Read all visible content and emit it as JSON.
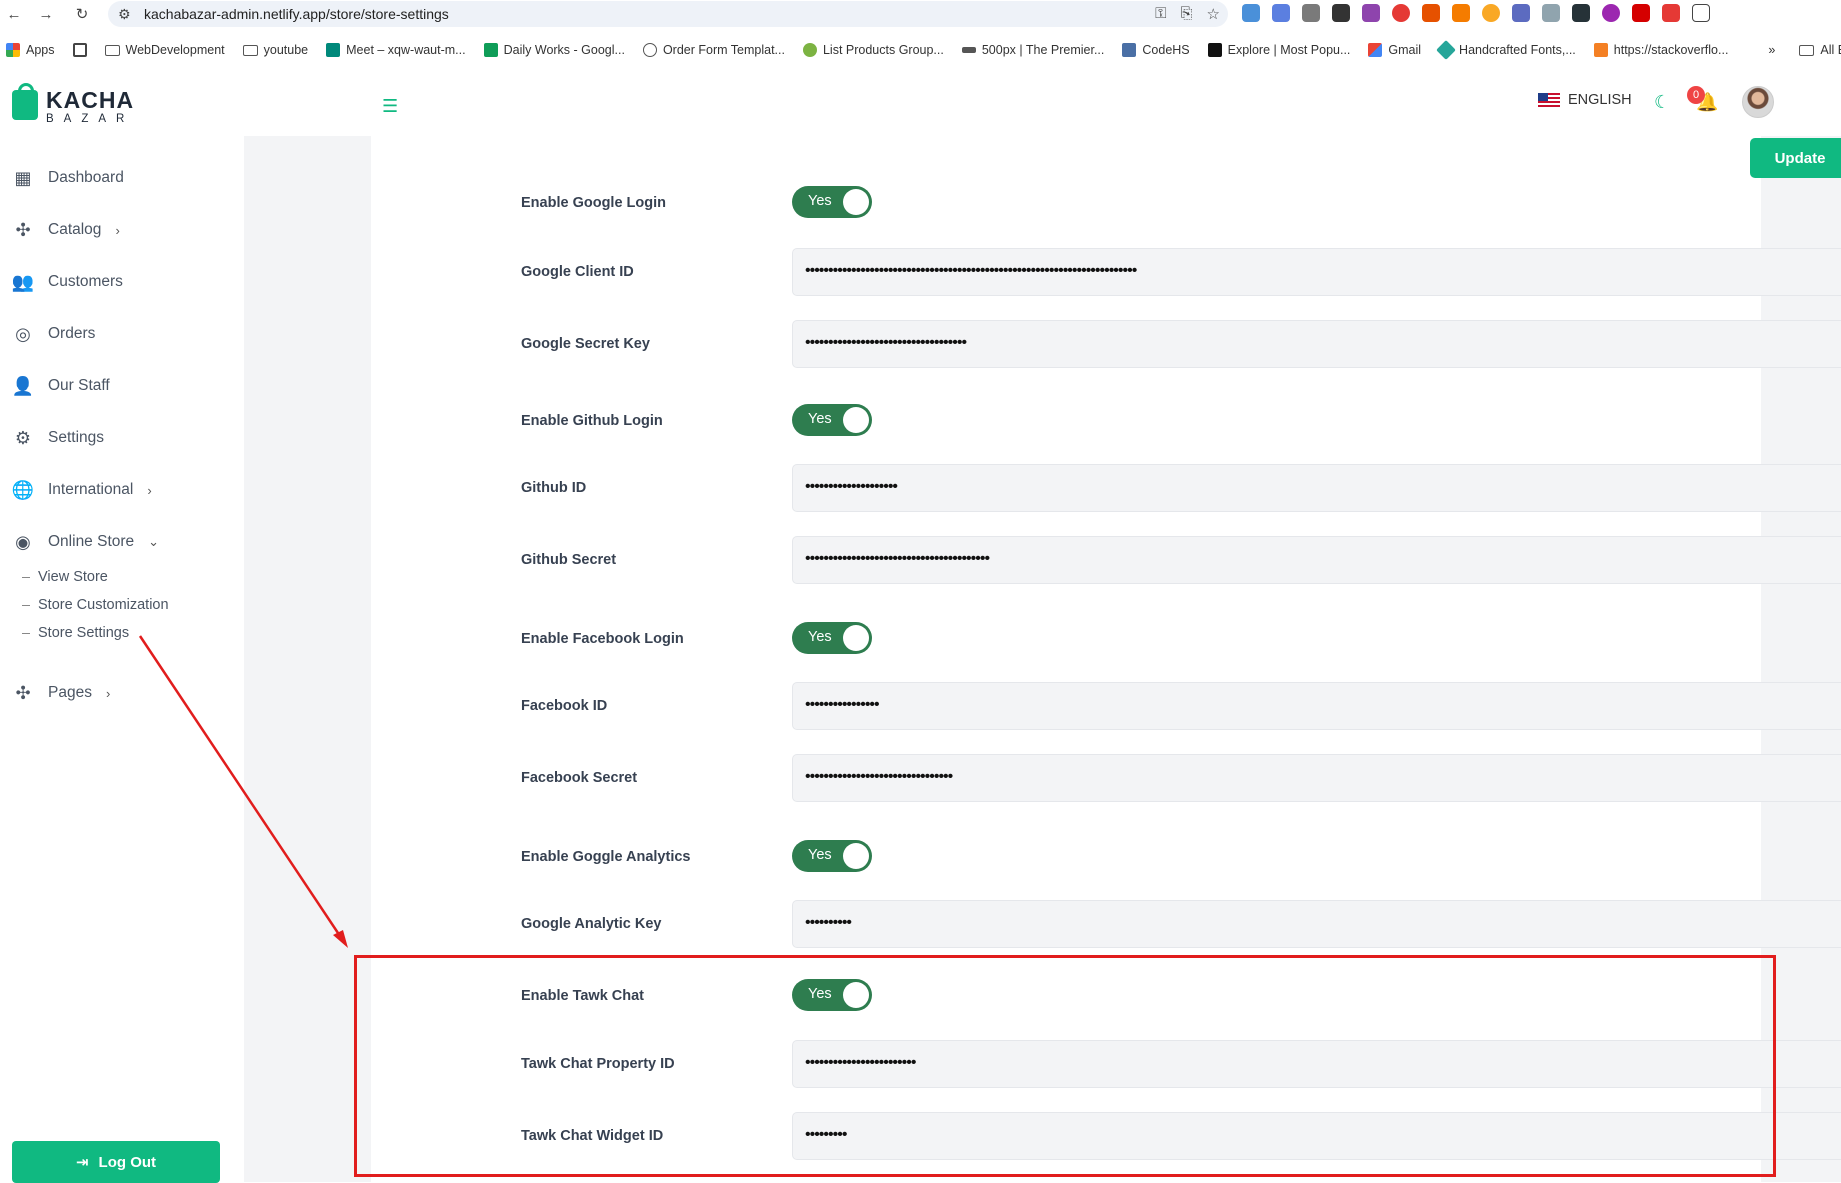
{
  "browser": {
    "url": "kachabazar-admin.netlify.app/store/store-settings",
    "bookmarks": [
      {
        "label": "Apps",
        "icon": "apps-grid-icon"
      },
      {
        "label": "",
        "icon": "grid-icon"
      },
      {
        "label": "WebDevelopment",
        "icon": "folder-icon"
      },
      {
        "label": "youtube",
        "icon": "folder-icon"
      },
      {
        "label": "Meet – xqw-waut-m...",
        "icon": "meet-icon"
      },
      {
        "label": "Daily Works - Googl...",
        "icon": "sheets-icon"
      },
      {
        "label": "Order Form Templat...",
        "icon": "globe-icon"
      },
      {
        "label": "List Products Group...",
        "icon": "gear-icon"
      },
      {
        "label": "500px | The Premier...",
        "icon": "500px-icon"
      },
      {
        "label": "CodeHS",
        "icon": "codehs-icon"
      },
      {
        "label": "Explore | Most Popu...",
        "icon": "explore-icon"
      },
      {
        "label": "Gmail",
        "icon": "gmail-icon"
      },
      {
        "label": "Handcrafted Fonts,...",
        "icon": "tag-icon"
      },
      {
        "label": "https://stackoverflo...",
        "icon": "stackoverflow-icon"
      }
    ],
    "more_bookmarks": "»",
    "all_bookmarks": "All B"
  },
  "brand": {
    "name": "KACHA",
    "sub": "BAZAR",
    "accent": "#10b981"
  },
  "sidebar": {
    "items": [
      {
        "label": "Dashboard",
        "icon": "dashboard-grid-icon"
      },
      {
        "label": "Catalog",
        "icon": "catalog-icon",
        "chevron": "›"
      },
      {
        "label": "Customers",
        "icon": "users-icon"
      },
      {
        "label": "Orders",
        "icon": "compass-icon"
      },
      {
        "label": "Our Staff",
        "icon": "user-icon"
      },
      {
        "label": "Settings",
        "icon": "gear-icon"
      },
      {
        "label": "International",
        "icon": "globe-icon",
        "chevron": "›"
      },
      {
        "label": "Online Store",
        "icon": "target-icon",
        "chevron": "⌄"
      }
    ],
    "subitems": [
      {
        "label": "View Store"
      },
      {
        "label": "Store Customization"
      },
      {
        "label": "Store Settings"
      }
    ],
    "pages": {
      "label": "Pages",
      "icon": "pages-icon",
      "chevron": "›"
    },
    "logout": "Log Out"
  },
  "header": {
    "language": "ENGLISH",
    "notification_count": "0"
  },
  "form": {
    "update_label": "Update",
    "toggle_yes": "Yes",
    "rows": [
      {
        "label": "Enable Google Login",
        "type": "toggle"
      },
      {
        "label": "Google Client ID",
        "type": "field",
        "value": "••••••••••••••••••••••••••••••••••••••••••••••••••••••••••••••••••••••••"
      },
      {
        "label": "Google Secret Key",
        "type": "field",
        "value": "•••••••••••••••••••••••••••••••••••"
      },
      {
        "label": "Enable Github Login",
        "type": "toggle"
      },
      {
        "label": "Github ID",
        "type": "field",
        "value": "••••••••••••••••••••"
      },
      {
        "label": "Github Secret",
        "type": "field",
        "value": "••••••••••••••••••••••••••••••••••••••••"
      },
      {
        "label": "Enable Facebook Login",
        "type": "toggle"
      },
      {
        "label": "Facebook ID",
        "type": "field",
        "value": "••••••••••••••••"
      },
      {
        "label": "Facebook Secret",
        "type": "field",
        "value": "••••••••••••••••••••••••••••••••"
      },
      {
        "label": "Enable Goggle Analytics",
        "type": "toggle"
      },
      {
        "label": "Google Analytic Key",
        "type": "field",
        "value": "••••••••••"
      },
      {
        "label": "Enable Tawk Chat",
        "type": "toggle"
      },
      {
        "label": "Tawk Chat Property ID",
        "type": "field",
        "value": "••••••••••••••••••••••••"
      },
      {
        "label": "Tawk Chat Widget ID",
        "type": "field",
        "value": "•••••••••"
      }
    ]
  },
  "annotation": {
    "color": "#e11d1d"
  }
}
